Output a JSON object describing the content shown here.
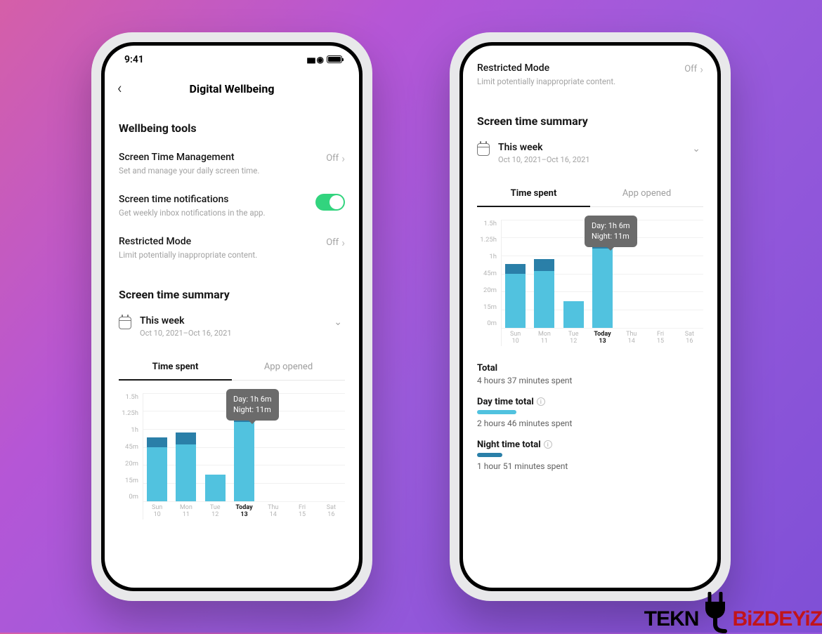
{
  "status": {
    "time": "9:41"
  },
  "header": {
    "title": "Digital Wellbeing"
  },
  "sections": {
    "tools_heading": "Wellbeing tools",
    "summary_heading": "Screen time summary"
  },
  "rows": {
    "stm": {
      "title": "Screen Time Management",
      "sub": "Set and manage your daily screen time.",
      "value": "Off"
    },
    "notif": {
      "title": "Screen time notifications",
      "sub": "Get weekly inbox notifications in the app."
    },
    "restricted": {
      "title": "Restricted Mode",
      "sub": "Limit potentially inappropriate content.",
      "value": "Off"
    }
  },
  "week": {
    "label": "This week",
    "range": "Oct 10, 2021–Oct 16, 2021"
  },
  "tabs": {
    "time_spent": "Time spent",
    "app_opened": "App opened"
  },
  "tooltip": {
    "day": "Day: 1h 6m",
    "night": "Night: 11m"
  },
  "totals": {
    "total_label": "Total",
    "total_value": "4 hours 37 minutes spent",
    "day_label": "Day time total",
    "day_value": "2 hours 46 minutes spent",
    "night_label": "Night time total",
    "night_value": "1 hour 51 minutes spent"
  },
  "watermark": {
    "part1": "TEKN",
    "part2": "BiZDEYiZ"
  },
  "chart_data": {
    "type": "bar",
    "title": "Time spent",
    "ylabel": "",
    "xlabel": "",
    "ylim": [
      0,
      90
    ],
    "y_ticks": [
      "1.5h",
      "1.25h",
      "1h",
      "45m",
      "20m",
      "15m",
      "0m"
    ],
    "categories": [
      "Sun 10",
      "Mon 11",
      "Tue 12",
      "Today 13",
      "Thu 14",
      "Fri 15",
      "Sat 16"
    ],
    "series": [
      {
        "name": "Day",
        "color": "#51c2df",
        "values": [
          45,
          47,
          22,
          66,
          0,
          0,
          0
        ]
      },
      {
        "name": "Night",
        "color": "#2a7fa8",
        "values": [
          8,
          10,
          0,
          11,
          0,
          0,
          0
        ]
      }
    ],
    "highlight_index": 3,
    "tooltip": {
      "index": 3,
      "lines": [
        "Day: 1h 6m",
        "Night: 11m"
      ]
    }
  }
}
